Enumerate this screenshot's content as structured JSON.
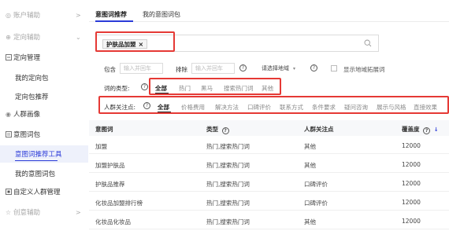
{
  "sidebar": {
    "items": [
      {
        "label": "账户辅助",
        "icon": "account-icon",
        "chevron": ">"
      },
      {
        "label": "定向辅助",
        "icon": "target-icon",
        "chevron": "⌄"
      },
      {
        "label": "定向管理",
        "icon": "manage-icon"
      },
      {
        "label": "我的定向包"
      },
      {
        "label": "定向包推荐"
      },
      {
        "label": "人群画像",
        "icon": "portrait-icon"
      },
      {
        "label": "意图词包",
        "icon": "intent-icon"
      },
      {
        "label": "意图词推荐工具"
      },
      {
        "label": "我的意图词包"
      },
      {
        "label": "自定义人群管理",
        "icon": "custom-icon"
      },
      {
        "label": "创意辅助",
        "icon": "creative-icon",
        "chevron": ">"
      }
    ]
  },
  "tabs": [
    {
      "label": "意图词推荐"
    },
    {
      "label": "我的意图词包"
    }
  ],
  "search": {
    "tag_label": "护肤品加盟",
    "tag_close": "×"
  },
  "filters": {
    "include_label": "包含",
    "include_placeholder": "输入并回车",
    "exclude_label": "排除",
    "exclude_placeholder": "输入并回车",
    "region_select": "请选择地域",
    "region_caret": "▾",
    "region_checkbox_label": "显示地域拓展词"
  },
  "word_type": {
    "label": "词的类型:",
    "options": [
      "全部",
      "热门",
      "黑马",
      "搜索热门词",
      "其他"
    ]
  },
  "audience": {
    "label": "人群关注点:",
    "options": [
      "全部",
      "价格费用",
      "解决方法",
      "口碑评价",
      "联系方式",
      "条件要求",
      "疑问咨询",
      "展示与风格",
      "直接效果"
    ]
  },
  "table": {
    "headers": [
      "意图词",
      "类型",
      "人群关注点",
      "覆盖度"
    ],
    "sort_arrow": "↓",
    "rows": [
      [
        "加盟",
        "热门,搜索热门词",
        "其他",
        "12000"
      ],
      [
        "加盟护肤品",
        "热门,搜索热门词",
        "其他",
        "12000"
      ],
      [
        "护肤品推荐",
        "热门,搜索热门词",
        "口碑评价",
        "12000"
      ],
      [
        "化妆品加盟排行榜",
        "热门,搜索热门词",
        "口碑评价",
        "12000"
      ],
      [
        "化妆品化妆品",
        "热门,搜索热门词",
        "其他",
        "12000"
      ]
    ]
  },
  "colors": {
    "accent": "#2b3bd8",
    "highlight_box": "#e53935"
  }
}
